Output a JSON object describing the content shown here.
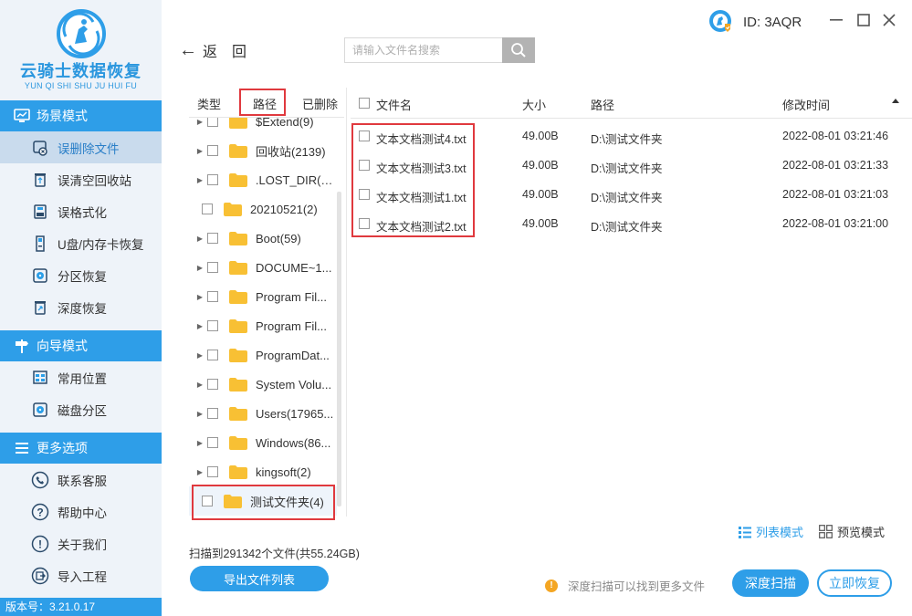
{
  "app": {
    "title": "云骑士数据恢复",
    "subtitle": "YUN QI SHI SHU JU HUI FU",
    "version": "版本号：3.21.0.17",
    "account_id": "ID: 3AQR"
  },
  "colors": {
    "accent": "#2e9ee8",
    "highlight_box": "#e0393e",
    "folder": "#f8c034"
  },
  "sidebar": {
    "sections": [
      {
        "label": "场景模式",
        "icon": "monitor-icon",
        "items": [
          {
            "label": "误删除文件",
            "icon": "deleted-file-icon",
            "active": true
          },
          {
            "label": "误清空回收站",
            "icon": "recycle-bin-icon"
          },
          {
            "label": "误格式化",
            "icon": "format-disk-icon"
          },
          {
            "label": "U盘/内存卡恢复",
            "icon": "sd-card-icon"
          },
          {
            "label": "分区恢复",
            "icon": "partition-icon"
          },
          {
            "label": "深度恢复",
            "icon": "deep-restore-icon"
          }
        ]
      },
      {
        "label": "向导模式",
        "icon": "signpost-icon",
        "items": [
          {
            "label": "常用位置",
            "icon": "window-icon"
          },
          {
            "label": "磁盘分区",
            "icon": "disk-icon"
          }
        ]
      },
      {
        "label": "更多选项",
        "icon": "menu-icon",
        "items": [
          {
            "label": "联系客服",
            "icon": "phone-icon"
          },
          {
            "label": "帮助中心",
            "icon": "question-icon"
          },
          {
            "label": "关于我们",
            "icon": "info-icon"
          },
          {
            "label": "导入工程",
            "icon": "import-icon"
          }
        ]
      }
    ]
  },
  "topbar": {
    "back_label": "返",
    "back_label2": "回",
    "search_placeholder": "请输入文件名搜索"
  },
  "tree": {
    "tabs": [
      "类型",
      "路径",
      "已删除"
    ],
    "rows": [
      {
        "label": "$Extend(9)",
        "expandable": true
      },
      {
        "label": "回收站(2139)",
        "expandable": true
      },
      {
        "label": ".LOST_DIR(5...",
        "expandable": true
      },
      {
        "label": "20210521(2)",
        "expandable": false
      },
      {
        "label": "Boot(59)",
        "expandable": true
      },
      {
        "label": "DOCUME~1...",
        "expandable": true
      },
      {
        "label": "Program Fil...",
        "expandable": true
      },
      {
        "label": "Program Fil...",
        "expandable": true
      },
      {
        "label": "ProgramDat...",
        "expandable": true
      },
      {
        "label": "System Volu...",
        "expandable": true
      },
      {
        "label": "Users(17965...",
        "expandable": true
      },
      {
        "label": "Windows(86...",
        "expandable": true
      },
      {
        "label": "kingsoft(2)",
        "expandable": true
      },
      {
        "label": "测试文件夹(4)",
        "expandable": false,
        "selected": true
      }
    ]
  },
  "table": {
    "columns": [
      "文件名",
      "大小",
      "路径",
      "修改时间"
    ],
    "rows": [
      {
        "name": "文本文档测试4.txt",
        "size": "49.00B",
        "path": "D:\\测试文件夹",
        "mtime": "2022-08-01 03:21:46"
      },
      {
        "name": "文本文档测试3.txt",
        "size": "49.00B",
        "path": "D:\\测试文件夹",
        "mtime": "2022-08-01 03:21:33"
      },
      {
        "name": "文本文档测试1.txt",
        "size": "49.00B",
        "path": "D:\\测试文件夹",
        "mtime": "2022-08-01 03:21:03"
      },
      {
        "name": "文本文档测试2.txt",
        "size": "49.00B",
        "path": "D:\\测试文件夹",
        "mtime": "2022-08-01 03:21:00"
      }
    ]
  },
  "footer": {
    "list_mode": "列表模式",
    "preview_mode": "预览模式",
    "scan_summary": "扫描到291342个文件(共55.24GB)",
    "export_label": "导出文件列表",
    "tip": "深度扫描可以找到更多文件",
    "deep_scan_label": "深度扫描",
    "recover_label": "立即恢复"
  }
}
